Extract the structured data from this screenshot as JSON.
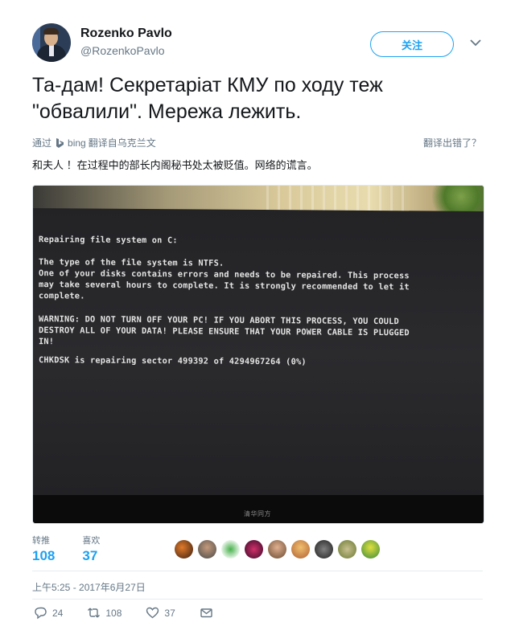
{
  "user": {
    "name": "Rozenko Pavlo",
    "handle": "@RozenkoPavlo"
  },
  "follow_label": "关注",
  "tweet_text": "Та-дам! Секретаріат КМУ по ходу теж \"обвалили\". Мережа лежить.",
  "translation": {
    "via_label": "通过",
    "bing_label": "bing",
    "source_label": "翻译自乌克兰文",
    "wrong_label": "翻译出错了？",
    "text": "和夫人 ！在过程中的部长内阁秘书处太被贬值。网络的谎言。"
  },
  "screen_text": {
    "line1": "Repairing file system on C:",
    "line2": "The type of the file system is NTFS.",
    "line3": "One of your disks contains errors and needs to be repaired. This process",
    "line4": "may take several hours to complete. It is strongly recommended to let it",
    "line5": "complete.",
    "line6": "WARNING: DO NOT TURN OFF YOUR PC! IF YOU ABORT THIS PROCESS, YOU COULD",
    "line7": "DESTROY ALL OF YOUR DATA! PLEASE ENSURE THAT YOUR POWER CABLE IS PLUGGED",
    "line8": "IN!",
    "line9": "CHKDSK is repairing sector 499392 of 4294967264 (0%)",
    "monitor_brand": "清华同方"
  },
  "stats": {
    "retweets_label": "转推",
    "retweets": "108",
    "likes_label": "喜欢",
    "likes": "37"
  },
  "timestamp": "上午5:25 - 2017年6月27日",
  "actions": {
    "replies": "24",
    "retweets": "108",
    "likes": "37"
  },
  "icons": [
    "chevron-down-icon",
    "bing-logo-icon",
    "reply-icon",
    "retweet-icon",
    "heart-icon",
    "envelope-icon"
  ],
  "colors": {
    "accent": "#1da1f2",
    "muted": "#657786",
    "text": "#14171a"
  }
}
